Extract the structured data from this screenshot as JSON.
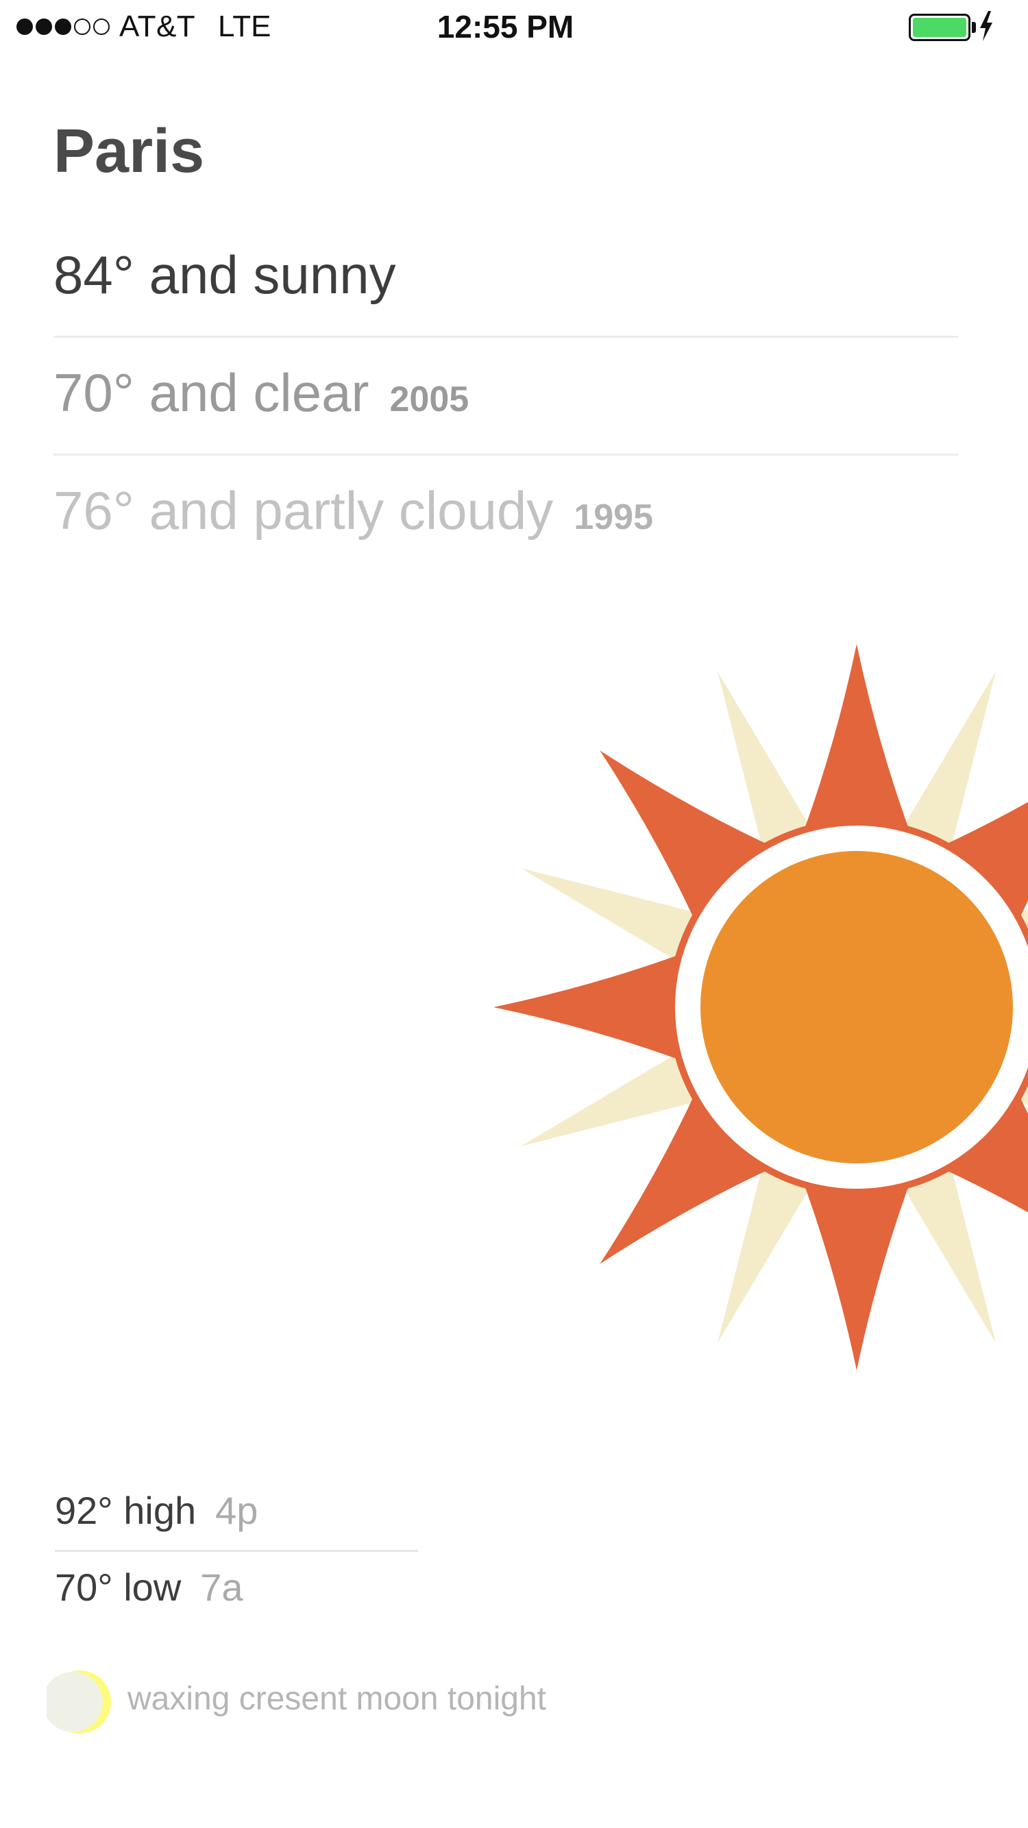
{
  "status_bar": {
    "signal_dots_filled": 3,
    "signal_dots_total": 5,
    "carrier": "AT&T",
    "network": "LTE",
    "time": "12:55 PM",
    "battery_level": 1.0,
    "battery_charging": true
  },
  "city": "Paris",
  "current": {
    "text": "84° and sunny"
  },
  "history": [
    {
      "text": "70° and clear",
      "year": "2005"
    },
    {
      "text": "76° and partly cloudy",
      "year": "1995"
    }
  ],
  "forecast": {
    "high_text": "92° high",
    "high_time": "4p",
    "low_text": "70° low",
    "low_time": "7a"
  },
  "moon": {
    "text": "waxing cresent moon tonight"
  },
  "colors": {
    "sun_core": "#ec902e",
    "sun_rays": "#e3653b",
    "sun_back_rays": "#f4ebc9",
    "battery": "#4cd964",
    "moon_crescent": "#fdfb7a",
    "moon_dark": "#f0f1e6"
  },
  "icons": {
    "weather": "sun-icon",
    "moon": "moon-icon",
    "charging": "bolt-icon"
  }
}
